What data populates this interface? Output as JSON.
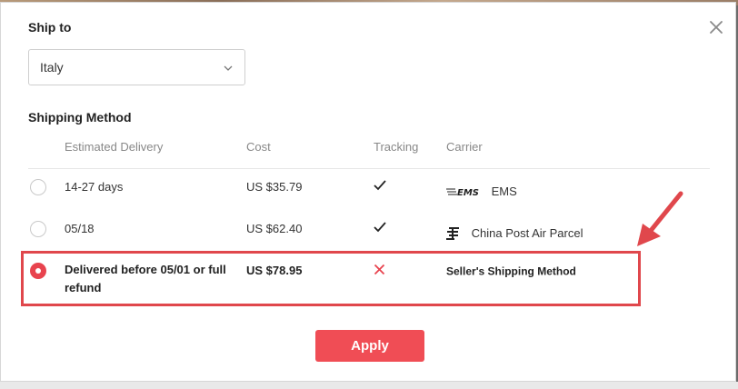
{
  "ship_to": {
    "title": "Ship to",
    "country_value": "Italy"
  },
  "shipping_method": {
    "title": "Shipping Method",
    "columns": {
      "delivery": "Estimated Delivery",
      "cost": "Cost",
      "tracking": "Tracking",
      "carrier": "Carrier"
    },
    "options": [
      {
        "delivery": "14-27 days",
        "cost": "US $35.79",
        "tracking": true,
        "carrier_logo_text": "EMS",
        "carrier": "EMS",
        "selected": false
      },
      {
        "delivery": "05/18",
        "cost": "US $62.40",
        "tracking": true,
        "carrier": "China Post Air Parcel",
        "selected": false
      },
      {
        "delivery": "Delivered before 05/01 or full refund",
        "cost": "US $78.95",
        "tracking": false,
        "carrier": "Seller's Shipping Method",
        "selected": true
      }
    ]
  },
  "apply_label": "Apply",
  "colors": {
    "accent": "#f04d55",
    "selected_radio": "#e8434e",
    "highlight": "#e0474c",
    "cross": "#e8434e"
  }
}
